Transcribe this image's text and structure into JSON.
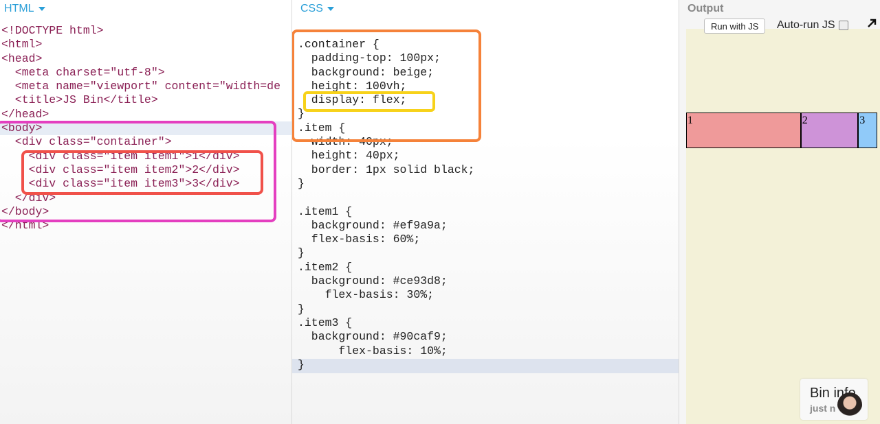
{
  "html_panel": {
    "label": "HTML",
    "lines": [
      "<!DOCTYPE html>",
      "<html>",
      "<head>",
      "  <meta charset=\"utf-8\">",
      "  <meta name=\"viewport\" content=\"width=de",
      "  <title>JS Bin</title>",
      "</head>",
      "<body>",
      "  <div class=\"container\">",
      "    <div class=\"item item1\">1</div>",
      "    <div class=\"item item2\">2</div>",
      "    <div class=\"item item3\">3</div>",
      "  </div>",
      "</body>",
      "</html>"
    ]
  },
  "css_panel": {
    "label": "CSS",
    "lines": [
      ".container {",
      "  padding-top: 100px;",
      "  background: beige;",
      "  height: 100vh;",
      "  display: flex;",
      "}",
      ".item {",
      "  width: 40px;",
      "  height: 40px;",
      "  border: 1px solid black;",
      "}",
      "",
      ".item1 {",
      "  background: #ef9a9a;",
      "  flex-basis: 60%;",
      "}",
      ".item2 {",
      "  background: #ce93d8;",
      "    flex-basis: 30%;",
      "}",
      ".item3 {",
      "  background: #90caf9;",
      "      flex-basis: 10%;",
      "}"
    ]
  },
  "output_panel": {
    "label": "Output",
    "run_button": "Run with JS",
    "autorun_label": "Auto-run JS",
    "autorun_checked": false,
    "items": [
      {
        "label": "1",
        "color": "#ef9a9a",
        "basis_percent": 60
      },
      {
        "label": "2",
        "color": "#ce93d8",
        "basis_percent": 30
      },
      {
        "label": "3",
        "color": "#90caf9",
        "basis_percent": 10
      }
    ],
    "bin_info": {
      "title": "Bin info",
      "subtitle": "just n"
    }
  },
  "colors": {
    "accent": "#2a9fd8",
    "highlight_body": "#e43fc0",
    "highlight_items": "#f0514a",
    "highlight_container": "#f5823a",
    "highlight_display": "#f7d21a",
    "output_bg": "#f3f1d8"
  },
  "icons": [
    "caret-down-icon",
    "expand-icon"
  ]
}
